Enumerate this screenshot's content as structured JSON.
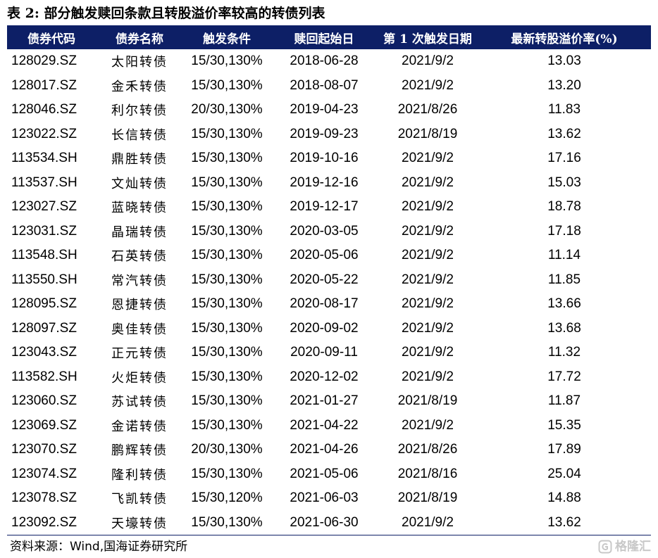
{
  "title": "表 2:  部分触发赎回条款且转股溢价率较高的转债列表",
  "colors": {
    "header_bg": "#0d1f66",
    "header_text": "#ffffff",
    "watermark": "#c8c8c8"
  },
  "table": {
    "headers": [
      "债券代码",
      "债券名称",
      "触发条件",
      "赎回起始日",
      "第 1 次触发日期",
      "最新转股溢价率(%)"
    ],
    "rows": [
      [
        "128029.SZ",
        "太阳转债",
        "15/30,130%",
        "2018-06-28",
        "2021/9/2",
        "13.03"
      ],
      [
        "128017.SZ",
        "金禾转债",
        "15/30,130%",
        "2018-08-07",
        "2021/9/2",
        "13.20"
      ],
      [
        "128046.SZ",
        "利尔转债",
        "20/30,130%",
        "2019-04-23",
        "2021/8/26",
        "11.83"
      ],
      [
        "123022.SZ",
        "长信转债",
        "15/30,130%",
        "2019-09-23",
        "2021/8/19",
        "13.62"
      ],
      [
        "113534.SH",
        "鼎胜转债",
        "15/30,130%",
        "2019-10-16",
        "2021/9/2",
        "17.16"
      ],
      [
        "113537.SH",
        "文灿转债",
        "15/30,130%",
        "2019-12-16",
        "2021/9/2",
        "15.03"
      ],
      [
        "123027.SZ",
        "蓝晓转债",
        "15/30,130%",
        "2019-12-17",
        "2021/9/2",
        "18.78"
      ],
      [
        "123031.SZ",
        "晶瑞转债",
        "15/30,130%",
        "2020-03-05",
        "2021/9/2",
        "17.18"
      ],
      [
        "113548.SH",
        "石英转债",
        "15/30,130%",
        "2020-05-06",
        "2021/9/2",
        "11.14"
      ],
      [
        "113550.SH",
        "常汽转债",
        "15/30,130%",
        "2020-05-22",
        "2021/9/2",
        "11.85"
      ],
      [
        "128095.SZ",
        "恩捷转债",
        "15/30,130%",
        "2020-08-17",
        "2021/9/2",
        "13.66"
      ],
      [
        "128097.SZ",
        "奥佳转债",
        "15/30,130%",
        "2020-09-02",
        "2021/9/2",
        "13.68"
      ],
      [
        "123043.SZ",
        "正元转债",
        "15/30,130%",
        "2020-09-11",
        "2021/9/2",
        "11.32"
      ],
      [
        "113582.SH",
        "火炬转债",
        "15/30,130%",
        "2020-12-02",
        "2021/9/2",
        "17.72"
      ],
      [
        "123060.SZ",
        "苏试转债",
        "15/30,130%",
        "2021-01-27",
        "2021/8/19",
        "11.87"
      ],
      [
        "123069.SZ",
        "金诺转债",
        "15/30,130%",
        "2021-04-22",
        "2021/9/2",
        "15.35"
      ],
      [
        "123070.SZ",
        "鹏辉转债",
        "20/30,130%",
        "2021-04-26",
        "2021/8/26",
        "17.89"
      ],
      [
        "123074.SZ",
        "隆利转债",
        "15/30,130%",
        "2021-05-06",
        "2021/8/16",
        "25.04"
      ],
      [
        "123078.SZ",
        "飞凯转债",
        "15/30,120%",
        "2021-06-03",
        "2021/8/19",
        "14.88"
      ],
      [
        "123092.SZ",
        "天壕转债",
        "15/30,130%",
        "2021-06-30",
        "2021/9/2",
        "13.62"
      ]
    ]
  },
  "source": "资料来源：Wind,国海证券研究所",
  "watermark": {
    "icon": "gelonghui-logo-icon",
    "text": "格隆汇"
  }
}
